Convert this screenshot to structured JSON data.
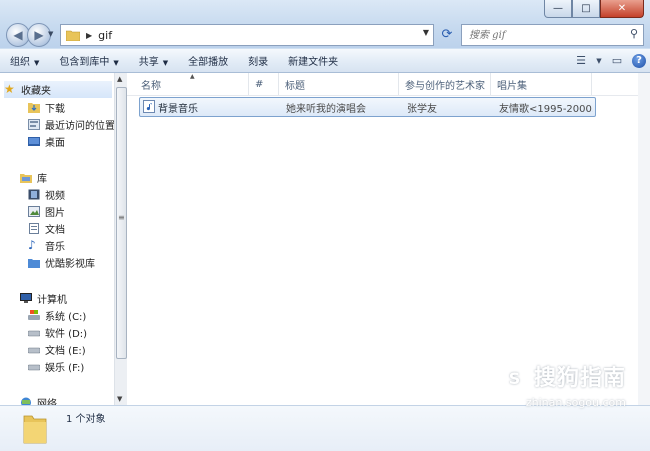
{
  "window": {
    "title_controls": {
      "minimize": "—",
      "maximize": "□",
      "close": "✕"
    }
  },
  "address": {
    "path_segment": "gif",
    "back_icon": "back-arrow-icon",
    "forward_icon": "forward-arrow-icon"
  },
  "search": {
    "placeholder": "搜索 gif"
  },
  "toolbar": {
    "organize": "组织",
    "include_in_library": "包含到库中",
    "share": "共享",
    "play_all": "全部播放",
    "burn": "刻录",
    "new_folder": "新建文件夹"
  },
  "nav": {
    "favorites": "收藏夹",
    "downloads": "下载",
    "recent": "最近访问的位置",
    "desktop": "桌面",
    "libraries": "库",
    "videos": "视频",
    "pictures": "图片",
    "documents": "文档",
    "music": "音乐",
    "youku": "优酷影视库",
    "computer": "计算机",
    "drive_c": "系统 (C:)",
    "drive_d": "软件 (D:)",
    "drive_e": "文档 (E:)",
    "drive_f": "娱乐 (F:)",
    "network": "网络"
  },
  "columns": {
    "name": "名称",
    "number": "#",
    "title": "标题",
    "artist": "参与创作的艺术家",
    "album": "唱片集"
  },
  "rows": [
    {
      "name": "背景音乐",
      "number": "",
      "title": "她来听我的演唱会",
      "artist": "张学友",
      "album": "友情歌<1995-2000..."
    }
  ],
  "details": {
    "count": "1 个对象"
  },
  "watermark": {
    "brand": "搜狗指南",
    "url": "zhinan.sogou.com"
  },
  "colors": {
    "accent": "#2a5db0",
    "selection": "#dde9f8",
    "chrome": "#c7daef"
  }
}
